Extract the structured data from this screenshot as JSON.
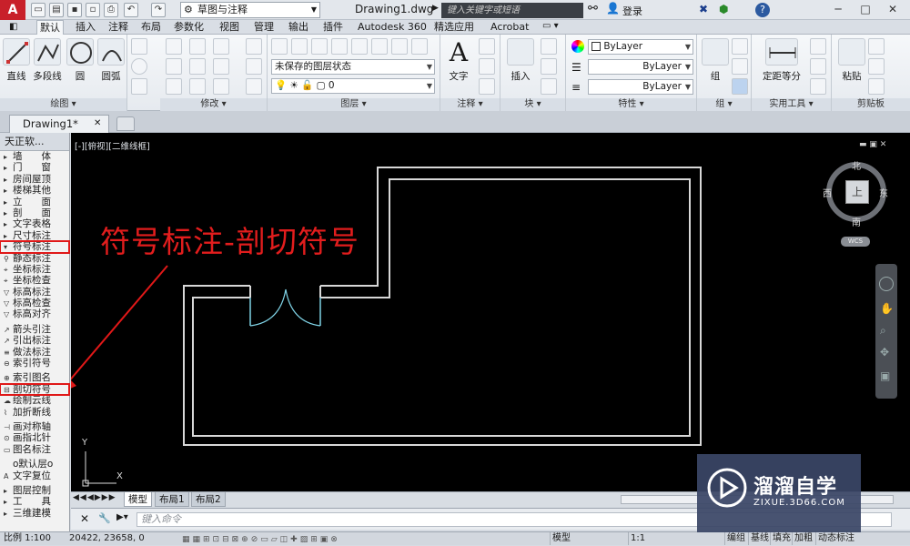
{
  "titlebar": {
    "logo": "A",
    "workspace": "草图与注释",
    "doc_title": "Drawing1.dwg",
    "search_placeholder": "键入关键字或短语",
    "login": "登录",
    "help": "?"
  },
  "ribbon_tabs": [
    "默认",
    "插入",
    "注释",
    "布局",
    "参数化",
    "视图",
    "管理",
    "输出",
    "插件",
    "Autodesk 360",
    "精选应用",
    "Acrobat"
  ],
  "ribbon": {
    "draw": {
      "label": "绘图 ▾",
      "buttons": [
        "直线",
        "多段线",
        "圆",
        "圆弧"
      ]
    },
    "modify": {
      "label": "修改 ▾"
    },
    "layers": {
      "label": "图层 ▾",
      "layer_state": "未保存的图层状态",
      "current_layer": "0"
    },
    "annotation": {
      "label": "注释 ▾",
      "button": "文字"
    },
    "block": {
      "label": "块 ▾",
      "button": "插入"
    },
    "properties": {
      "label": "特性 ▾",
      "color": "ByLayer",
      "linetype": "ByLayer",
      "lineweight": "ByLayer"
    },
    "groups": {
      "label": "组 ▾",
      "button": "组"
    },
    "utilities": {
      "label": "实用工具 ▾",
      "button": "定距等分"
    },
    "clipboard": {
      "label": "剪贴板",
      "button": "粘贴"
    }
  },
  "doc_tab": "Drawing1*",
  "sidebar": {
    "title": "天正软...",
    "items": [
      "墙　　体",
      "门　　窗",
      "房间屋顶",
      "楼梯其他",
      "立　　面",
      "剖　　面",
      "文字表格",
      "尺寸标注",
      "符号标注",
      "静态标注",
      "坐标标注",
      "坐标检查",
      "标高标注",
      "标高检查",
      "标高对齐",
      "箭头引注",
      "引出标注",
      "做法标注",
      "索引符号",
      "索引图名",
      "剖切符号",
      "绘制云线",
      "加折断线",
      "画对称轴",
      "画指北针",
      "图名标注",
      "o默认层o",
      "文字复位",
      "图层控制",
      "工　　具",
      "三维建模"
    ]
  },
  "viewport": {
    "label": "[-][俯视][二维线框]",
    "annotation": "符号标注-剖切符号"
  },
  "viewcube": {
    "north": "北",
    "south": "南",
    "east": "东",
    "west": "西",
    "face": "上",
    "wcs": "WCS"
  },
  "ucs": {
    "x": "X",
    "y": "Y"
  },
  "layout_tabs": [
    "模型",
    "布局1",
    "布局2"
  ],
  "cmdline": {
    "placeholder": "键入命令"
  },
  "statusbar": {
    "scale": "比例 1:100",
    "coords": "20422, 23658, 0",
    "model": "模型",
    "anno_scale": "1:1",
    "buttons": [
      "编组",
      "基线",
      "填充",
      "加粗",
      "动态标注"
    ]
  },
  "watermark": {
    "title": "溜溜自学",
    "url": "ZIXUE.3D66.COM"
  }
}
